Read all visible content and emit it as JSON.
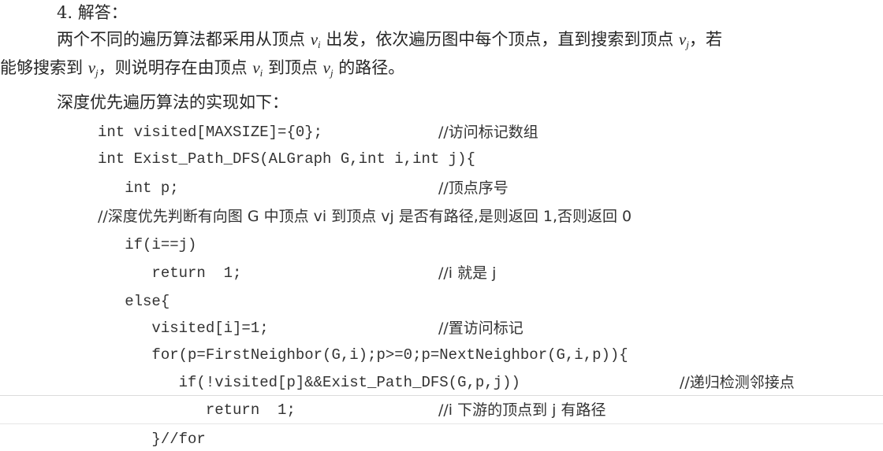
{
  "heading": "4. 解答：",
  "para1": {
    "t1": "两个不同的遍历算法都采用从顶点 ",
    "v1": "v",
    "s1": "i",
    "t2": " 出发，依次遍历图中每个顶点，直到搜索到顶点 ",
    "v2": "v",
    "s2": "j",
    "t3": "，若"
  },
  "para2": {
    "t1": "能够搜索到 ",
    "v1": "v",
    "s1": "j",
    "t2": "，则说明存在由顶点 ",
    "v2": "v",
    "s2": "i",
    "t3": " 到顶点 ",
    "v3": "v",
    "s3": "j",
    "t4": " 的路径。"
  },
  "intro": "深度优先遍历算法的实现如下：",
  "code": [
    {
      "code": "int visited[MAXSIZE]={0};",
      "comment": "//访问标记数组"
    },
    {
      "code": "int Exist_Path_DFS(ALGraph G,int i,int j){",
      "comment": ""
    },
    {
      "code": "   int p;",
      "comment": "//顶点序号"
    },
    {
      "code": "",
      "comment": "//深度优先判断有向图 G 中顶点 vi 到顶点 vj 是否有路径,是则返回 1,否则返回 0"
    },
    {
      "code": "   if(i==j)",
      "comment": ""
    },
    {
      "code": "      return  1;",
      "comment": "//i 就是 j"
    },
    {
      "code": "   else{",
      "comment": ""
    },
    {
      "code": "      visited[i]=1;",
      "comment": "//置访问标记"
    },
    {
      "code": "      for(p=FirstNeighbor(G,i);p>=0;p=NextNeighbor(G,i,p)){",
      "comment": ""
    },
    {
      "code": "         if(!visited[p]&&Exist_Path_DFS(G,p,j))",
      "comment": "//递归检测邻接点"
    },
    {
      "code": "            return  1;",
      "comment": "//i 下游的顶点到 j 有路径"
    },
    {
      "code": "      }//for",
      "comment": ""
    }
  ]
}
